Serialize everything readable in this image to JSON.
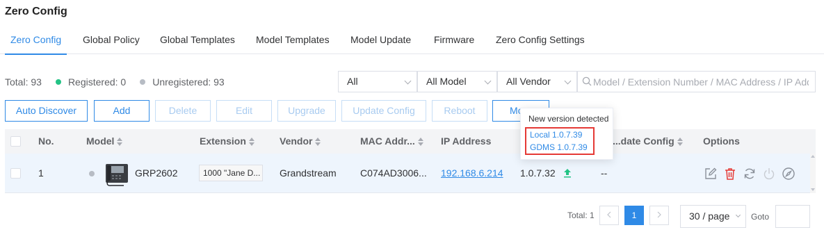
{
  "page": {
    "title": "Zero Config"
  },
  "tabs": [
    {
      "label": "Zero Config"
    },
    {
      "label": "Global Policy"
    },
    {
      "label": "Global Templates"
    },
    {
      "label": "Model Templates"
    },
    {
      "label": "Model Update"
    },
    {
      "label": "Firmware"
    },
    {
      "label": "Zero Config Settings"
    }
  ],
  "stats": {
    "total": "Total: 93",
    "registered": "Registered: 0",
    "unregistered": "Unregistered: 93"
  },
  "filters": {
    "status": "All",
    "model": "All Model",
    "vendor": "All Vendor",
    "search_placeholder": "Model / Extension Number / MAC Address / IP Address"
  },
  "toolbar": {
    "auto_discover": "Auto Discover",
    "add": "Add",
    "delete": "Delete",
    "edit": "Edit",
    "upgrade": "Upgrade",
    "update_config": "Update Config",
    "reboot": "Reboot",
    "more": "More"
  },
  "table": {
    "headers": {
      "no": "No.",
      "model": "Model",
      "extension": "Extension",
      "vendor": "Vendor",
      "mac": "MAC Addr...",
      "ip": "IP Address",
      "update_config": "...date Config",
      "options": "Options"
    },
    "rows": [
      {
        "no": "1",
        "model": "GRP2602",
        "extension": "1000 \"Jane D...",
        "vendor": "Grandstream",
        "mac": "C074AD3006...",
        "ip": "192.168.6.214",
        "version": "1.0.7.32",
        "update_config": "--"
      }
    ]
  },
  "popover": {
    "title": "New version detected",
    "local": "Local 1.0.7.39",
    "gdms": "GDMS 1.0.7.39"
  },
  "pagination": {
    "total": "Total: 1",
    "current_page": "1",
    "page_size": "30 / page",
    "goto_label": "Goto",
    "goto_value": ""
  },
  "colors": {
    "accent": "#2f8ae6",
    "registered": "#23c385",
    "unregistered": "#b7bcc4",
    "delete_icon": "#e53935",
    "highlight_box": "#e53935"
  },
  "icons": [
    "search-icon",
    "chevron-down-icon",
    "sort-icon",
    "phone-device-icon",
    "upgrade-available-icon",
    "edit-icon",
    "trash-icon",
    "refresh-icon",
    "power-icon",
    "compass-icon",
    "chevron-left-icon",
    "chevron-right-icon"
  ]
}
